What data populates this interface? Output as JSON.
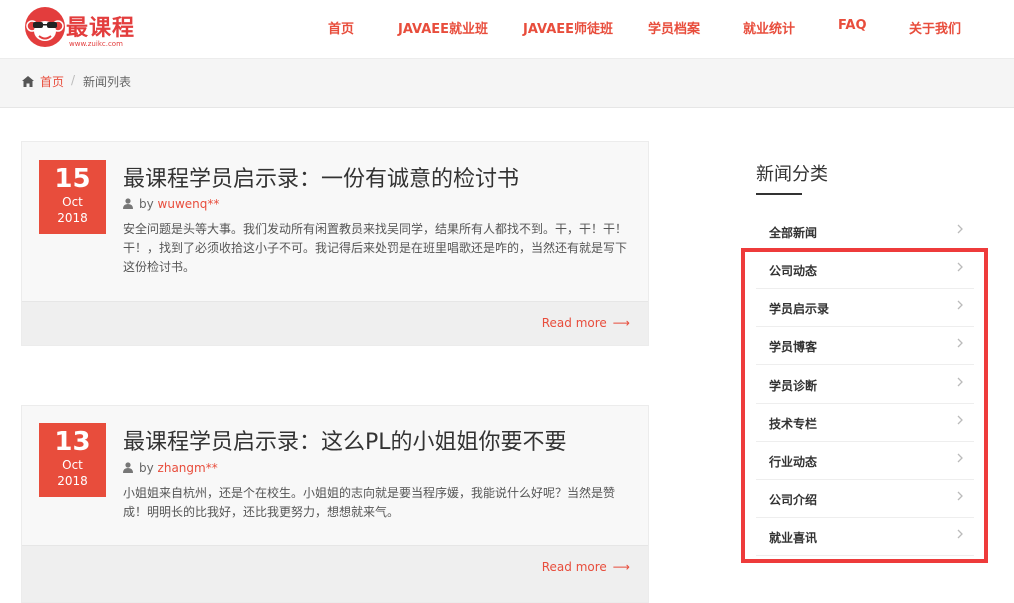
{
  "brand": {
    "name": "最课程",
    "url_text": "www.zuikc.com",
    "color": "#e84d3c"
  },
  "nav": [
    {
      "label": "首页"
    },
    {
      "label": "JAVAEE就业班"
    },
    {
      "label": "JAVAEE师徒班"
    },
    {
      "label": "学员档案"
    },
    {
      "label": "就业统计"
    },
    {
      "label": "FAQ"
    },
    {
      "label": "关于我们"
    }
  ],
  "breadcrumb": {
    "home": "首页",
    "separator": "/",
    "current": "新闻列表"
  },
  "posts": [
    {
      "day": "15",
      "month": "Oct",
      "year": "2018",
      "title": "最课程学员启示录：一份有诚意的检讨书",
      "by": "by",
      "author": "wuwenq**",
      "excerpt": "安全问题是头等大事。我们发动所有闲置教员来找吴同学，结果所有人都找不到。干，干！干！干！，找到了必须收拾这小子不可。我记得后来处罚是在班里唱歌还是咋的，当然还有就是写下这份检讨书。",
      "readmore": "Read more"
    },
    {
      "day": "13",
      "month": "Oct",
      "year": "2018",
      "title": "最课程学员启示录：这么PL的小姐姐你要不要",
      "by": "by",
      "author": "zhangm**",
      "excerpt": "小姐姐来自杭州，还是个在校生。小姐姐的志向就是要当程序媛，我能说什么好呢？当然是赞成！明明长的比我好，还比我更努力，想想就来气。",
      "readmore": "Read more"
    }
  ],
  "sidebar": {
    "title": "新闻分类",
    "categories": [
      {
        "label": "全部新闻"
      },
      {
        "label": "公司动态"
      },
      {
        "label": "学员启示录"
      },
      {
        "label": "学员博客"
      },
      {
        "label": "学员诊断"
      },
      {
        "label": "技术专栏"
      },
      {
        "label": "行业动态"
      },
      {
        "label": "公司介绍"
      },
      {
        "label": "就业喜讯"
      }
    ],
    "highlight_color": "#ee3b3b"
  }
}
